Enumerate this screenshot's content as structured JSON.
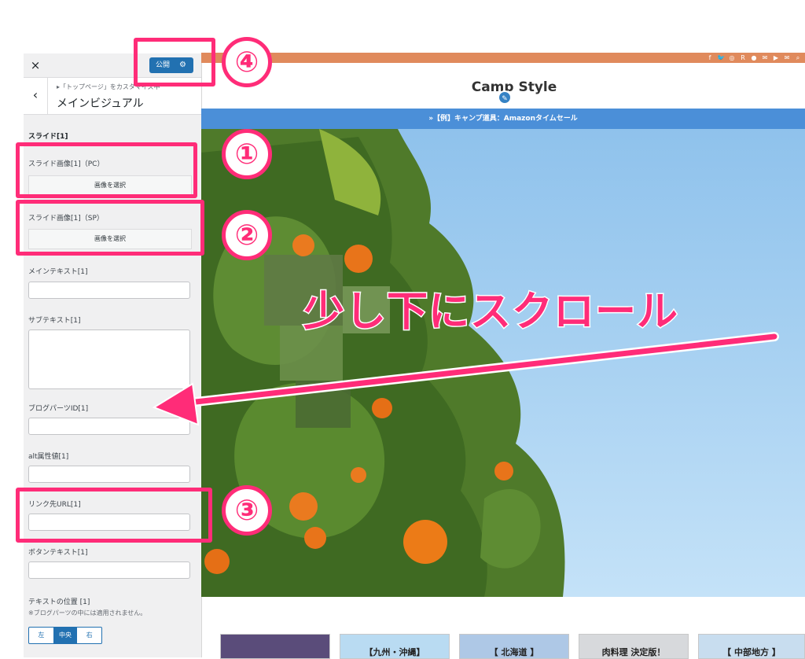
{
  "panel": {
    "close_icon": "×",
    "publish_label": "公開",
    "publish_icon": "⚙",
    "back_icon": "‹",
    "breadcrumb": "▸「トップページ」をカスタマイズ中",
    "title": "メインビジュアル",
    "slide_heading": "スライド[1]",
    "pc_image_label": "スライド画像[1]（PC）",
    "pc_image_button": "画像を選択",
    "sp_image_label": "スライド画像[1]（SP）",
    "sp_image_button": "画像を選択",
    "main_text_label": "メインテキスト[1]",
    "sub_text_label": "サブテキスト[1]",
    "blog_parts_label": "ブログパーツID[1]",
    "alt_label": "alt属性値[1]",
    "link_url_label": "リンク先URL[1]",
    "button_text_label": "ボタンテキスト[1]",
    "text_position_label": "テキストの位置 [1]",
    "text_position_note": "※ブログパーツの中には適用されません。",
    "align_options": [
      "左",
      "中央",
      "右"
    ],
    "align_selected": "中央"
  },
  "preview": {
    "social_icons": [
      "f",
      "🐦",
      "◎",
      "R",
      "●",
      "✉",
      "▶",
      "✉",
      "⌕"
    ],
    "site_title": "Camp Style",
    "edit_icon": "✎",
    "notice": "»【例】キャンプ道具：Amazonタイムセール",
    "cards": [
      "",
      "【九州・沖縄】",
      "【 北海道 】",
      "肉料理 決定版！",
      "【 中部地方 】"
    ]
  },
  "annotations": {
    "one": "①",
    "two": "②",
    "three": "③",
    "four": "④",
    "scroll_message": "少し下にスクロール"
  },
  "colors": {
    "accent_pink": "#ff2c78",
    "wp_blue": "#2271b1",
    "topbar_orange": "#e08a5c",
    "notice_blue": "#4b8fd8"
  }
}
